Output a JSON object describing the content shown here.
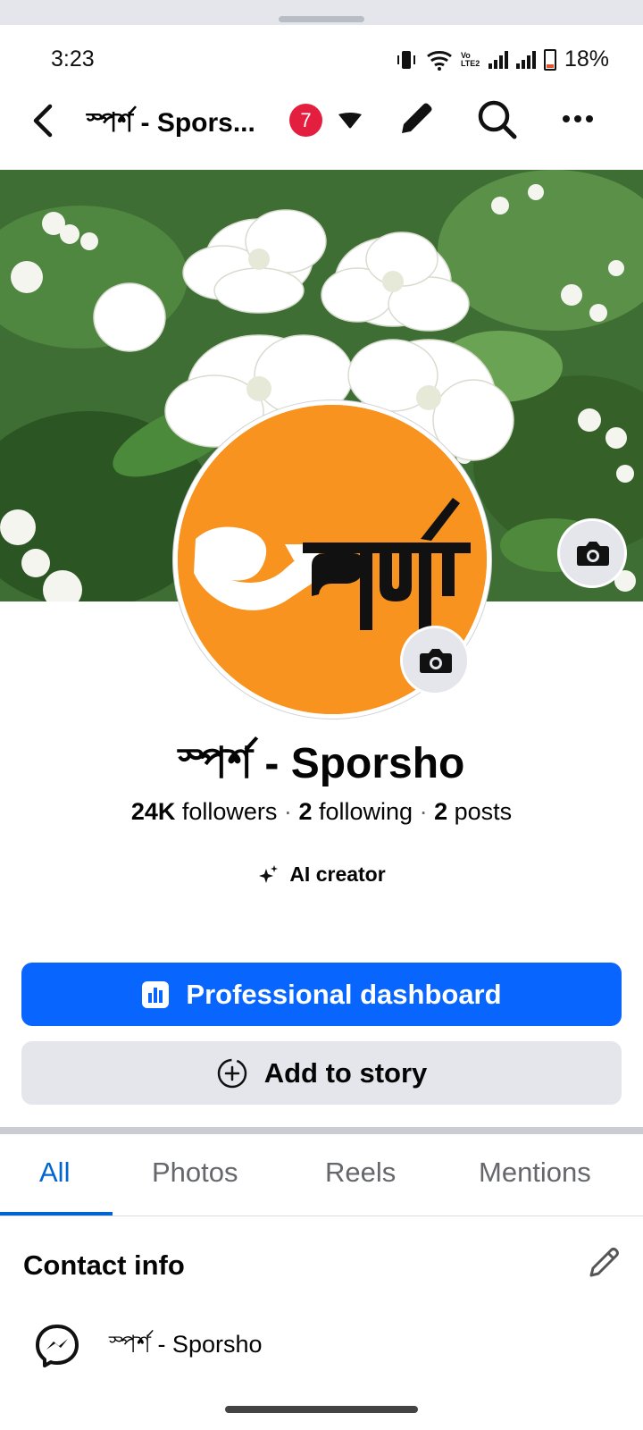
{
  "status_bar": {
    "time": "3:23",
    "volte_label": "Vo LTE2",
    "battery": "18%"
  },
  "app_bar": {
    "title": "স্পর্শ - Spors...",
    "notification_count": "7",
    "icons": [
      "back-arrow-icon",
      "caret-down-icon",
      "pencil-icon",
      "search-icon",
      "more-icon"
    ]
  },
  "cover": {
    "image": "white jasmine flowers with green leaves",
    "camera_icon": "camera-icon"
  },
  "avatar": {
    "logo_text": "স্পর্শ",
    "background": "#f7931e",
    "camera_icon": "camera-icon"
  },
  "profile": {
    "name": "স্পর্শ - Sporsho",
    "followers_count": "24K",
    "followers_label": "followers",
    "following_count": "2",
    "following_label": "following",
    "posts_count": "2",
    "posts_label": "posts",
    "separator": "·",
    "badge": "AI creator"
  },
  "buttons": {
    "primary": "Professional dashboard",
    "secondary": "Add to story"
  },
  "tabs": {
    "items": [
      "All",
      "Photos",
      "Reels",
      "Mentions"
    ],
    "active": "All"
  },
  "contact": {
    "title": "Contact info",
    "messenger": "স্পর্শ - Sporsho"
  },
  "colors": {
    "primary": "#0866ff",
    "active_tab": "#0064d1",
    "badge": "#e41e3f"
  }
}
